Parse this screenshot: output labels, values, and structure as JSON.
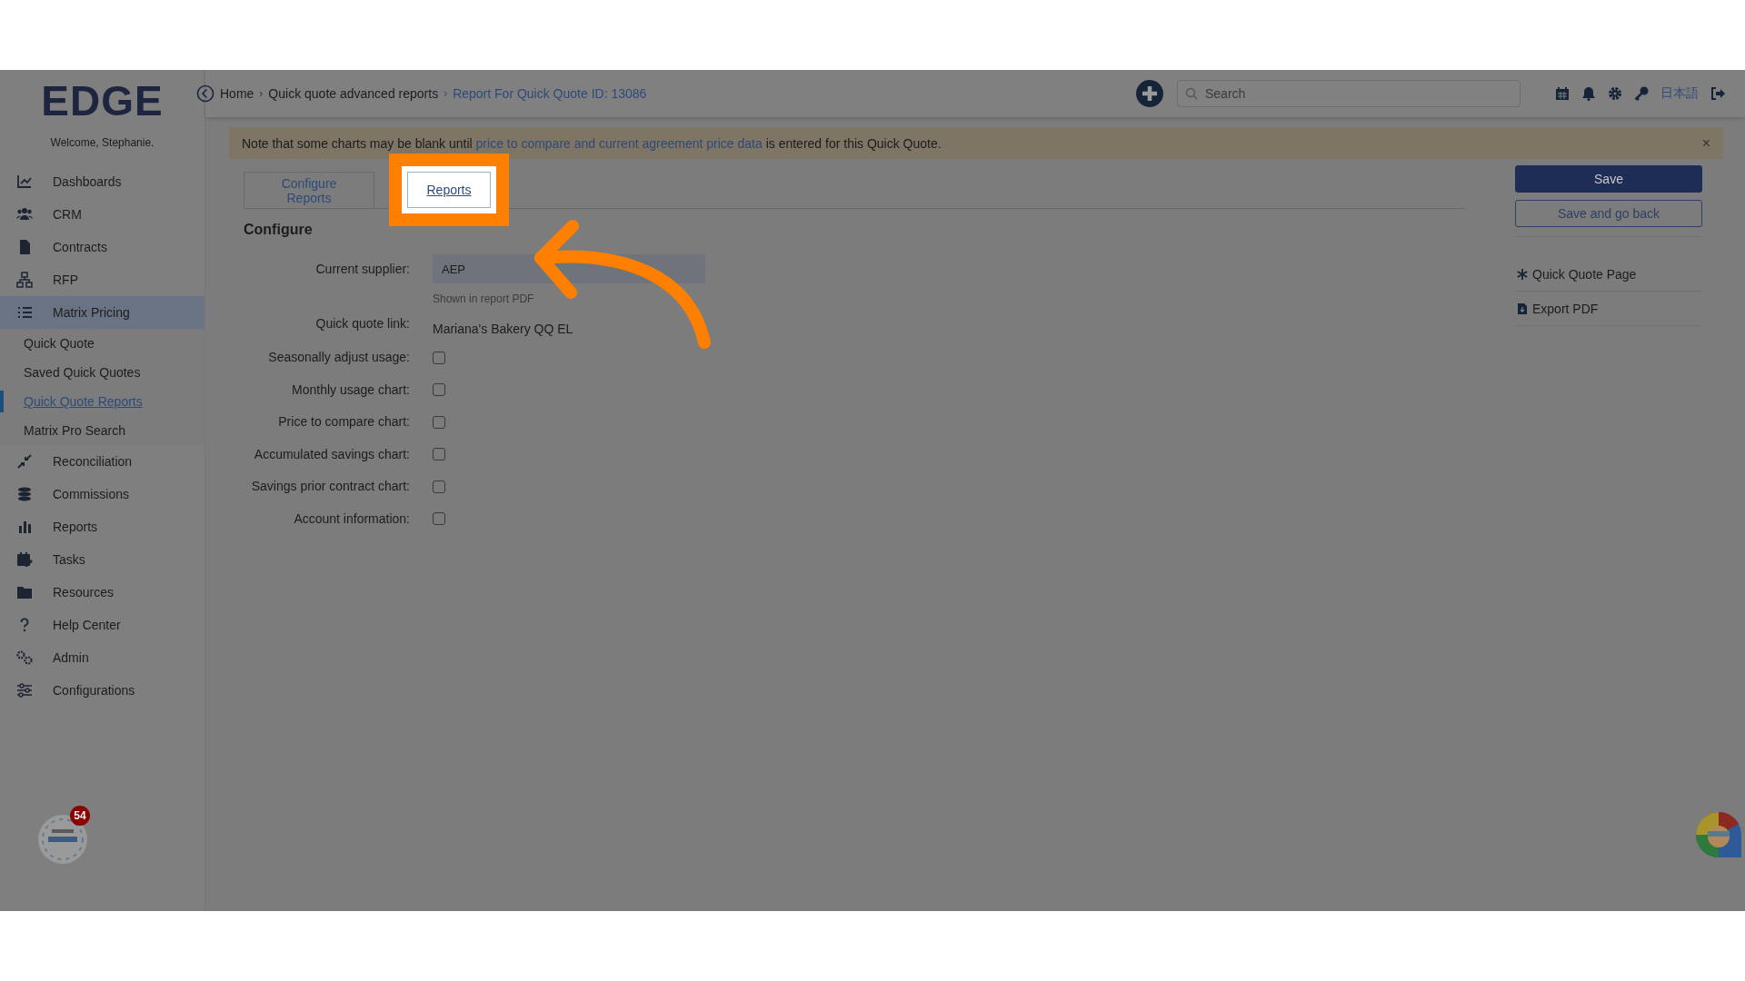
{
  "brand": {
    "logo": "EDGE",
    "welcome": "Welcome, Stephanie."
  },
  "sidebar": {
    "items": [
      {
        "label": "Dashboards",
        "expanded": false
      },
      {
        "label": "CRM",
        "expanded": false
      },
      {
        "label": "Contracts",
        "expanded": false
      },
      {
        "label": "RFP",
        "expanded": false
      },
      {
        "label": "Matrix Pricing",
        "expanded": true,
        "children": [
          {
            "label": "Quick Quote",
            "selected": false
          },
          {
            "label": "Saved Quick Quotes",
            "selected": false
          },
          {
            "label": "Quick Quote Reports",
            "selected": true
          },
          {
            "label": "Matrix Pro Search",
            "selected": false
          }
        ]
      },
      {
        "label": "Reconciliation",
        "expanded": false
      },
      {
        "label": "Commissions",
        "expanded": false
      },
      {
        "label": "Reports",
        "expanded": false
      },
      {
        "label": "Tasks",
        "expanded": false
      },
      {
        "label": "Resources",
        "expanded": false
      },
      {
        "label": "Help Center",
        "expanded": false
      },
      {
        "label": "Admin",
        "expanded": false
      },
      {
        "label": "Configurations",
        "expanded": false
      }
    ]
  },
  "breadcrumb": [
    {
      "label": "Home",
      "current": false
    },
    {
      "separator": "›",
      "label": "Quick quote advanced reports",
      "current": false
    },
    {
      "separator": "›",
      "label": "Report For Quick Quote ID: 13086",
      "current": true
    }
  ],
  "header": {
    "search": {
      "placeholder": "Search"
    },
    "language": "日本語"
  },
  "notice": {
    "before": "Note that some charts may be blank until ",
    "link": "price to compare and current agreement price data",
    "after": " is entered for this Quick Quote.",
    "close": "×"
  },
  "tabs": [
    {
      "label": "Configure Reports",
      "selected": true,
      "highlighted": false
    },
    {
      "label": "Reports",
      "selected": false,
      "highlighted": true
    }
  ],
  "form": {
    "heading": "Configure",
    "fields": [
      {
        "kind": "input",
        "label": "Current supplier:",
        "value": "AEP",
        "hint": "Shown in report PDF"
      },
      {
        "kind": "text",
        "label": "Quick quote link:",
        "value": "Mariana's Bakery QQ EL"
      },
      {
        "kind": "checkbox",
        "label": "Seasonally adjust usage:",
        "checked": false
      },
      {
        "kind": "checkbox",
        "label": "Monthly usage chart:",
        "checked": false
      },
      {
        "kind": "checkbox",
        "label": "Price to compare chart:",
        "checked": false
      },
      {
        "kind": "checkbox",
        "label": "Accumulated savings chart:",
        "checked": false
      },
      {
        "kind": "checkbox",
        "label": "Savings prior contract chart:",
        "checked": false
      },
      {
        "kind": "checkbox",
        "label": "Account information:",
        "checked": false
      }
    ]
  },
  "actions": {
    "buttons": [
      {
        "label": "Save",
        "kind": "primary"
      },
      {
        "label": "Save and go back",
        "kind": "secondary"
      }
    ],
    "links": [
      {
        "label": "Quick Quote Page",
        "kind": "asterisk"
      },
      {
        "label": "Export PDF",
        "kind": "pdf"
      }
    ]
  },
  "widget": {
    "count": "54"
  }
}
